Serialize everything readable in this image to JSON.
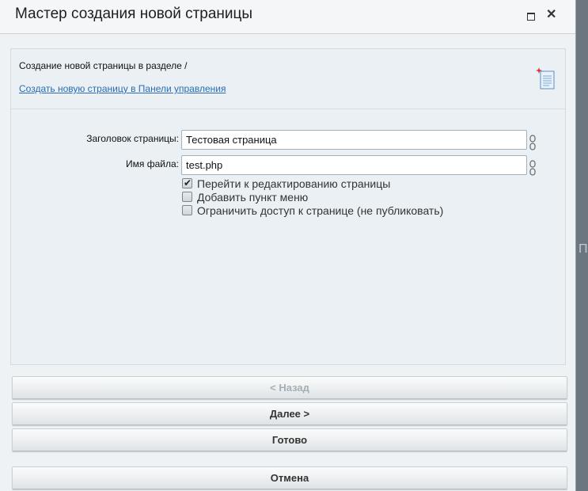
{
  "dialog": {
    "title": "Мастер создания новой страницы",
    "maximize_icon": "maximize-icon",
    "close_icon": "close-icon",
    "close_glyph": "✕"
  },
  "header": {
    "section_text": "Создание новой страницы в разделе /",
    "panel_link": "Создать новую страницу в Панели управления",
    "icon": "new-page-icon"
  },
  "form": {
    "title_label": "Заголовок страницы:",
    "title_value": "Тестовая страница",
    "file_label": "Имя файла:",
    "file_value": "test.php",
    "checkboxes": [
      {
        "label": "Перейти к редактированию страницы",
        "checked": true
      },
      {
        "label": "Добавить пункт меню",
        "checked": false
      },
      {
        "label": "Ограничить доступ к странице (не публиковать)",
        "checked": false
      }
    ],
    "check_glyph": "✔"
  },
  "buttons": {
    "back": "< Назад",
    "next": "Далее >",
    "done": "Готово",
    "cancel": "Отмена"
  },
  "background": {
    "letter": "П"
  },
  "colors": {
    "link": "#2b6db3",
    "disabled_text": "#a7aeb3"
  }
}
